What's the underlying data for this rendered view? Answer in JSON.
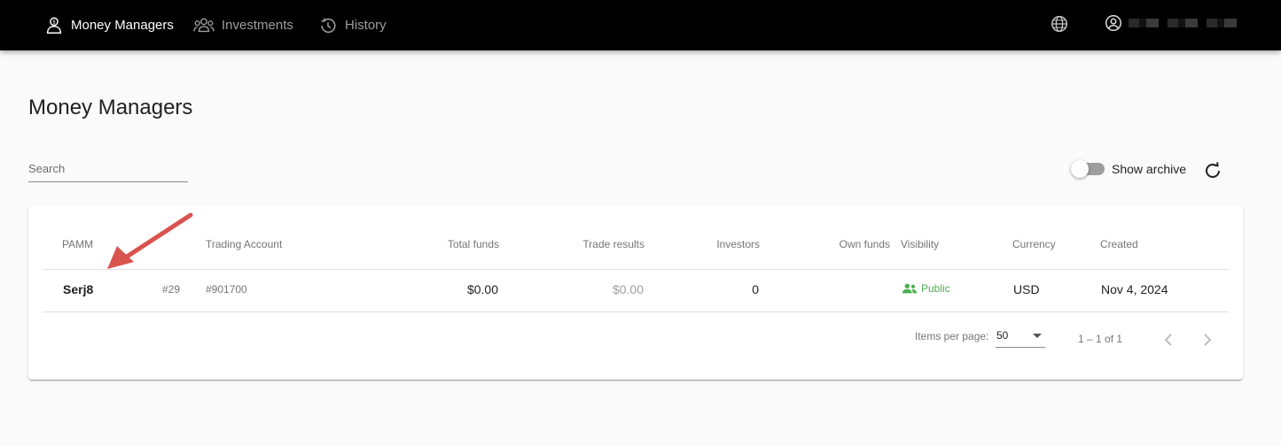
{
  "nav": {
    "items": [
      {
        "label": "Money Managers",
        "icon": "money-manager-icon",
        "active": true
      },
      {
        "label": "Investments",
        "icon": "group-icon",
        "active": false
      },
      {
        "label": "History",
        "icon": "history-icon",
        "active": false
      }
    ],
    "language_icon": "globe-icon",
    "account_icon": "account-circle-icon",
    "account_name": "████████"
  },
  "page": {
    "title": "Money Managers"
  },
  "search": {
    "placeholder": "Search"
  },
  "archive": {
    "label": "Show archive",
    "enabled": false
  },
  "table": {
    "columns": [
      "PAMM",
      "Trading Account",
      "Total funds",
      "Trade results",
      "Investors",
      "Own funds",
      "Visibility",
      "Currency",
      "Created"
    ],
    "rows": [
      {
        "name": "Serj8",
        "id": "#29",
        "account": "#901700",
        "total_funds": "$0.00",
        "trade_results": "$0.00",
        "investors": "0",
        "own_funds": "",
        "visibility": "Public",
        "currency": "USD",
        "created": "Nov 4, 2024"
      }
    ]
  },
  "pagination": {
    "items_per_page_label": "Items per page:",
    "items_per_page": "50",
    "range": "1 – 1 of 1"
  },
  "colors": {
    "nav_bg": "#000000",
    "public_green": "#4caf50",
    "annotation_arrow": "#d9534f"
  }
}
